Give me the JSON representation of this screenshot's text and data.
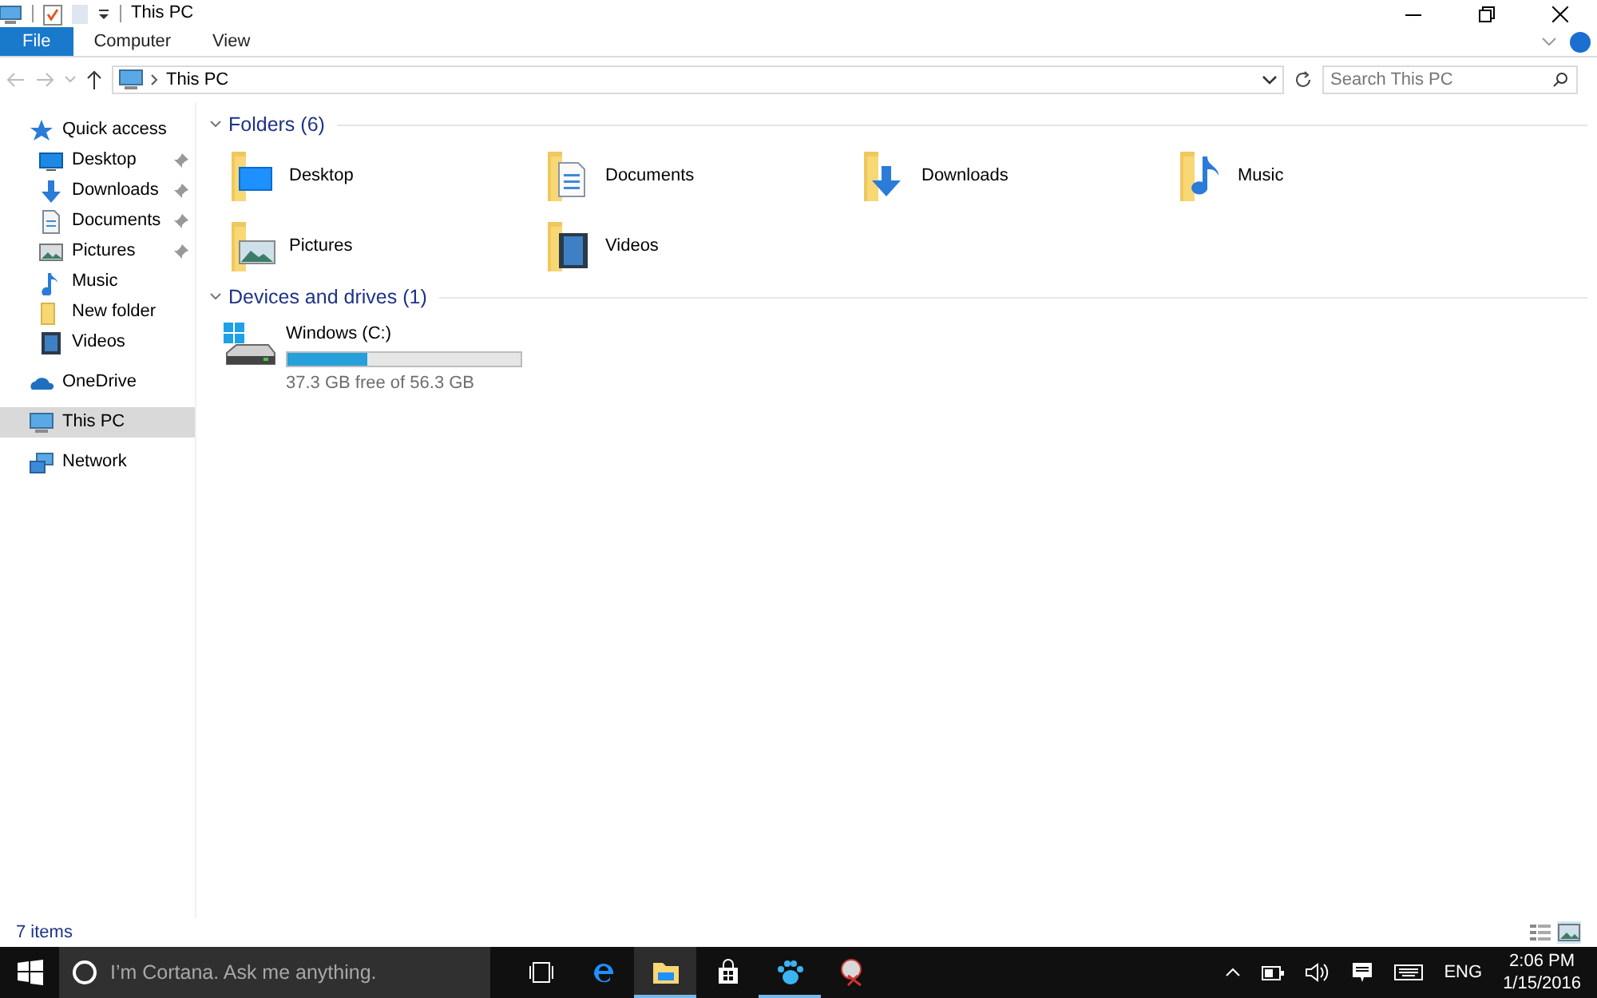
{
  "window": {
    "title": "This PC"
  },
  "ribbon": {
    "tabs": [
      {
        "label": "File",
        "kind": "file",
        "selected": false
      },
      {
        "label": "Computer",
        "kind": "tab",
        "selected": false
      },
      {
        "label": "View",
        "kind": "tab",
        "selected": false
      }
    ]
  },
  "address_bar": {
    "location": "This PC",
    "search_placeholder": "Search This PC"
  },
  "navigation": [
    {
      "label": "Quick access",
      "kind": "star",
      "selected": false,
      "children": [
        {
          "label": "Desktop",
          "kind": "desktop",
          "pinned": true,
          "selected": false
        },
        {
          "label": "Downloads",
          "kind": "downloads",
          "pinned": true,
          "selected": false
        },
        {
          "label": "Documents",
          "kind": "documents",
          "pinned": true,
          "selected": false
        },
        {
          "label": "Pictures",
          "kind": "pictures",
          "pinned": true,
          "selected": false
        },
        {
          "label": "Music",
          "kind": "music",
          "pinned": false,
          "selected": false
        },
        {
          "label": "New folder",
          "kind": "folder",
          "pinned": false,
          "selected": false
        },
        {
          "label": "Videos",
          "kind": "videos",
          "pinned": false,
          "selected": false
        }
      ]
    },
    {
      "label": "OneDrive",
      "kind": "cloud",
      "selected": false
    },
    {
      "label": "This PC",
      "kind": "pc",
      "selected": true
    },
    {
      "label": "Network",
      "kind": "network",
      "selected": false
    }
  ],
  "folders": {
    "title": "Folders (6)",
    "expanded": true,
    "items": [
      {
        "label": "Desktop",
        "kind": "desktop"
      },
      {
        "label": "Documents",
        "kind": "documents"
      },
      {
        "label": "Downloads",
        "kind": "downloads"
      },
      {
        "label": "Music",
        "kind": "music"
      },
      {
        "label": "Pictures",
        "kind": "pictures"
      },
      {
        "label": "Videos",
        "kind": "videos"
      }
    ]
  },
  "drives": {
    "title": "Devices and drives (1)",
    "expanded": true,
    "items": [
      {
        "label": "Windows (C:)",
        "level": 0.34,
        "space": "37.3 GB free of 56.3 GB"
      }
    ]
  },
  "status_bar": {
    "text": "7 items",
    "views": [
      {
        "kind": "details",
        "selected": false
      },
      {
        "kind": "large-icons",
        "selected": true
      }
    ]
  },
  "taskbar": {
    "search_placeholder": "I’m Cortana. Ask me anything.",
    "apps": [
      {
        "kind": "task-view",
        "active": false,
        "running": false
      },
      {
        "kind": "edge",
        "active": false,
        "running": false
      },
      {
        "kind": "explorer",
        "active": true,
        "running": true
      },
      {
        "kind": "store",
        "active": false,
        "running": false
      },
      {
        "kind": "paw",
        "active": false,
        "running": true
      },
      {
        "kind": "snipping",
        "active": false,
        "running": false
      }
    ],
    "language": "ENG",
    "time": "2:06 PM",
    "date": "1/15/2016"
  }
}
